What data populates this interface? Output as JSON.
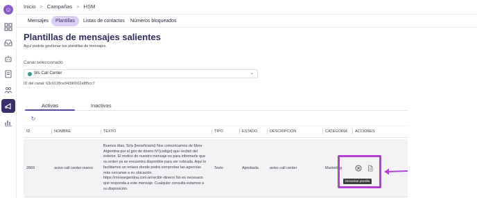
{
  "sidebar": {
    "logo_icon": "brand-logo-icon",
    "items": [
      {
        "name": "grid-icon"
      },
      {
        "name": "inbox-icon"
      },
      {
        "name": "robot-icon"
      },
      {
        "name": "contacts-book-icon"
      },
      {
        "name": "team-icon"
      },
      {
        "name": "campaigns-icon",
        "active": true
      },
      {
        "name": "analytics-icon"
      }
    ]
  },
  "breadcrumb": {
    "items": [
      "Inicio",
      "Campañas",
      "HSM"
    ],
    "separator": ">"
  },
  "topnav": {
    "tabs": [
      "Mensajes",
      "Plantillas",
      "Listas de contactos",
      "Números bloqueados"
    ],
    "active_index": 1
  },
  "page": {
    "title": "Plantillas de mensajes salientes",
    "subtitle": "Aquí podrás gestionar tus plantillas de mensajes."
  },
  "channel": {
    "label": "Canal seleccionado",
    "selected": "Ws Call Center",
    "id_text": "ID del canal: 63c0128ce34390002af85cc7"
  },
  "subtabs": {
    "tabs": [
      "Activas",
      "Inactivas"
    ],
    "active_index": 0
  },
  "table": {
    "columns": [
      "ID",
      "NOMBRE",
      "TEXTO",
      "TIPO",
      "ESTADO",
      "DESCRIPCIÓN",
      "CATEGORÍA",
      "ACCIONES"
    ],
    "rows": [
      {
        "id": "2869",
        "nombre": "aviso call center nuevo",
        "texto": "Buenos días, Sr/a {beneficiario} Nos comunicamos de More Argentina por el giro de dinero N°{codigo} que recibió del exterior. El motivo de nuestro mensaje es para informarle que su orden ya se encuentra disponible para ser cobrada. Aquí le facilitamos un enlace donde podrá comprobar las agencias más cercanas a su ubicación. https://moreargentina.com.ar/recibir-dinero/ No es necesario que responda a este mensaje. Cualquier consulta estamos a su disposición.",
        "tipo": "Texto",
        "estado": "Aprobada",
        "descripcion": "aviso call center",
        "categoria": "Marketing"
      }
    ]
  },
  "actions": {
    "deactivate_icon": "deactivate-icon",
    "document_icon": "document-icon",
    "tooltip": "Desactivar plantilla"
  },
  "colors": {
    "accent": "#5b4a9b",
    "highlight": "#b43fd6",
    "active_tab_bg": "#d9cff5",
    "sidebar_active": "#3a2d6b"
  }
}
